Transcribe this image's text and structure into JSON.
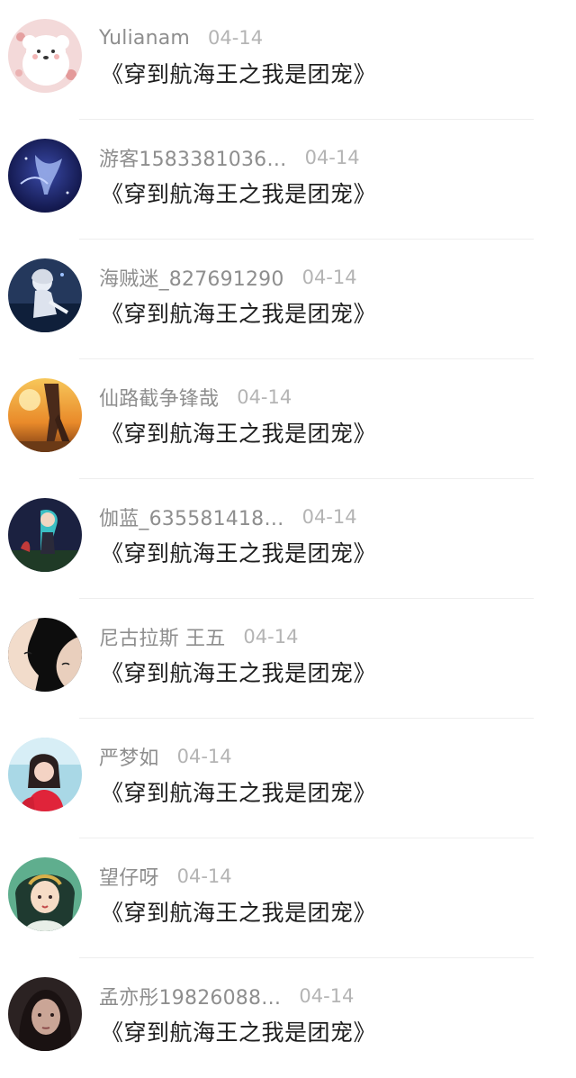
{
  "comments": [
    {
      "username": "Yulianam",
      "date": "04-14",
      "text": "《穿到航海王之我是团宠》",
      "avatar": "polar-bear-avatar"
    },
    {
      "username": "游客1583381036…",
      "date": "04-14",
      "text": "《穿到航海王之我是团宠》",
      "avatar": "dark-blue-figure-avatar"
    },
    {
      "username": "海贼迷_827691290",
      "date": "04-14",
      "text": "《穿到航海王之我是团宠》",
      "avatar": "anime-girl-avatar"
    },
    {
      "username": "仙路截争锋哉",
      "date": "04-14",
      "text": "《穿到航海王之我是团宠》",
      "avatar": "sunset-figure-avatar"
    },
    {
      "username": "伽蓝_635581418…",
      "date": "04-14",
      "text": "《穿到航海王之我是团宠》",
      "avatar": "anime-dark-avatar"
    },
    {
      "username": "尼古拉斯 王五",
      "date": "04-14",
      "text": "《穿到航海王之我是团宠》",
      "avatar": "silhouette-profile-avatar"
    },
    {
      "username": "严梦如",
      "date": "04-14",
      "text": "《穿到航海王之我是团宠》",
      "avatar": "girl-photo-avatar"
    },
    {
      "username": "望仔呀",
      "date": "04-14",
      "text": "《穿到航海王之我是团宠》",
      "avatar": "illustrated-lady-avatar"
    },
    {
      "username": "孟亦彤19826088…",
      "date": "04-14",
      "text": "《穿到航海王之我是团宠》",
      "avatar": "dark-portrait-avatar"
    }
  ]
}
